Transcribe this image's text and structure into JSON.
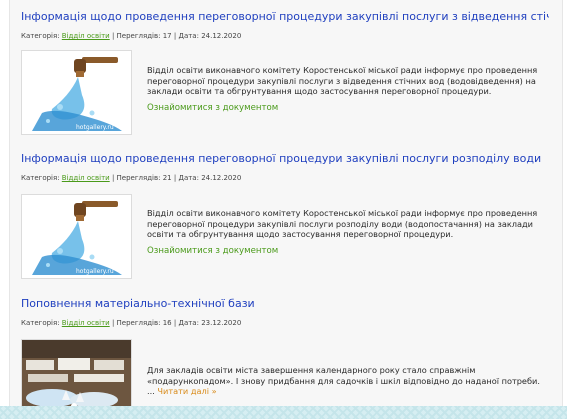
{
  "labels": {
    "category": "Категорія:",
    "views": "Переглядів:",
    "date": "Дата:",
    "separator": "|"
  },
  "articles": [
    {
      "title": "Інформація щодо проведення переговорної процедури закупівлі послуги з відведення стічних",
      "category": "Відділ освіти",
      "views": "17",
      "date": "24.12.2020",
      "text": "Відділ освіти виконавчого комітету Коростенської міської ради інформує про проведення переговорної процедури закупівлі послуги з відведення стічних вод (водовідведення) на заклади освіти та обгрунтування щодо застосування переговорної процедури.",
      "link": "Ознайомитися з документом",
      "watermark": "hotgallery.ru"
    },
    {
      "title": "Інформація щодо проведення переговорної процедури закупівлі послуги розподілу води",
      "category": "Відділ освіти",
      "views": "21",
      "date": "24.12.2020",
      "text": "Відділ освіти виконавчого комітету Коростенської міської ради інформує про проведення переговорної процедури закупівлі послуги розподілу води (водопостачання) на заклади освіти та обгрунтування щодо застосування переговорної процедури.",
      "link": "Ознайомитися з документом",
      "watermark": "hotgallery.ru"
    },
    {
      "title": "Поповнення матеріально-технічної бази",
      "category": "Відділ освіти",
      "views": "16",
      "date": "23.12.2020",
      "text": "Для закладів освіти міста завершення календарного року стало справжнім «подарункопадом». І знову придбання для садочків і шкіл відповідно до наданої потреби. ...",
      "link": "Читати далі »"
    }
  ]
}
